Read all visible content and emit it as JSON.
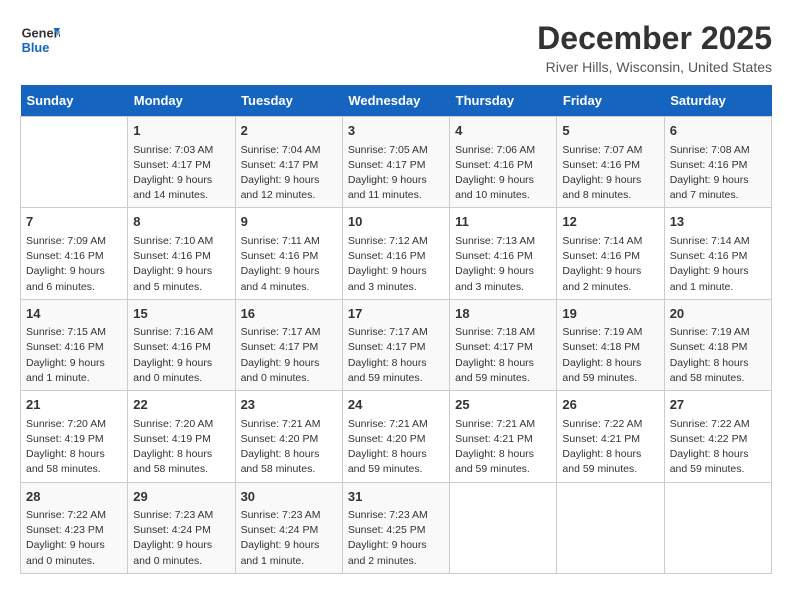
{
  "header": {
    "logo_line1": "General",
    "logo_line2": "Blue",
    "month_title": "December 2025",
    "location": "River Hills, Wisconsin, United States"
  },
  "days_of_week": [
    "Sunday",
    "Monday",
    "Tuesday",
    "Wednesday",
    "Thursday",
    "Friday",
    "Saturday"
  ],
  "weeks": [
    [
      {
        "day": "",
        "sunrise": "",
        "sunset": "",
        "daylight": ""
      },
      {
        "day": "1",
        "sunrise": "Sunrise: 7:03 AM",
        "sunset": "Sunset: 4:17 PM",
        "daylight": "Daylight: 9 hours and 14 minutes."
      },
      {
        "day": "2",
        "sunrise": "Sunrise: 7:04 AM",
        "sunset": "Sunset: 4:17 PM",
        "daylight": "Daylight: 9 hours and 12 minutes."
      },
      {
        "day": "3",
        "sunrise": "Sunrise: 7:05 AM",
        "sunset": "Sunset: 4:17 PM",
        "daylight": "Daylight: 9 hours and 11 minutes."
      },
      {
        "day": "4",
        "sunrise": "Sunrise: 7:06 AM",
        "sunset": "Sunset: 4:16 PM",
        "daylight": "Daylight: 9 hours and 10 minutes."
      },
      {
        "day": "5",
        "sunrise": "Sunrise: 7:07 AM",
        "sunset": "Sunset: 4:16 PM",
        "daylight": "Daylight: 9 hours and 8 minutes."
      },
      {
        "day": "6",
        "sunrise": "Sunrise: 7:08 AM",
        "sunset": "Sunset: 4:16 PM",
        "daylight": "Daylight: 9 hours and 7 minutes."
      }
    ],
    [
      {
        "day": "7",
        "sunrise": "Sunrise: 7:09 AM",
        "sunset": "Sunset: 4:16 PM",
        "daylight": "Daylight: 9 hours and 6 minutes."
      },
      {
        "day": "8",
        "sunrise": "Sunrise: 7:10 AM",
        "sunset": "Sunset: 4:16 PM",
        "daylight": "Daylight: 9 hours and 5 minutes."
      },
      {
        "day": "9",
        "sunrise": "Sunrise: 7:11 AM",
        "sunset": "Sunset: 4:16 PM",
        "daylight": "Daylight: 9 hours and 4 minutes."
      },
      {
        "day": "10",
        "sunrise": "Sunrise: 7:12 AM",
        "sunset": "Sunset: 4:16 PM",
        "daylight": "Daylight: 9 hours and 3 minutes."
      },
      {
        "day": "11",
        "sunrise": "Sunrise: 7:13 AM",
        "sunset": "Sunset: 4:16 PM",
        "daylight": "Daylight: 9 hours and 3 minutes."
      },
      {
        "day": "12",
        "sunrise": "Sunrise: 7:14 AM",
        "sunset": "Sunset: 4:16 PM",
        "daylight": "Daylight: 9 hours and 2 minutes."
      },
      {
        "day": "13",
        "sunrise": "Sunrise: 7:14 AM",
        "sunset": "Sunset: 4:16 PM",
        "daylight": "Daylight: 9 hours and 1 minute."
      }
    ],
    [
      {
        "day": "14",
        "sunrise": "Sunrise: 7:15 AM",
        "sunset": "Sunset: 4:16 PM",
        "daylight": "Daylight: 9 hours and 1 minute."
      },
      {
        "day": "15",
        "sunrise": "Sunrise: 7:16 AM",
        "sunset": "Sunset: 4:16 PM",
        "daylight": "Daylight: 9 hours and 0 minutes."
      },
      {
        "day": "16",
        "sunrise": "Sunrise: 7:17 AM",
        "sunset": "Sunset: 4:17 PM",
        "daylight": "Daylight: 9 hours and 0 minutes."
      },
      {
        "day": "17",
        "sunrise": "Sunrise: 7:17 AM",
        "sunset": "Sunset: 4:17 PM",
        "daylight": "Daylight: 8 hours and 59 minutes."
      },
      {
        "day": "18",
        "sunrise": "Sunrise: 7:18 AM",
        "sunset": "Sunset: 4:17 PM",
        "daylight": "Daylight: 8 hours and 59 minutes."
      },
      {
        "day": "19",
        "sunrise": "Sunrise: 7:19 AM",
        "sunset": "Sunset: 4:18 PM",
        "daylight": "Daylight: 8 hours and 59 minutes."
      },
      {
        "day": "20",
        "sunrise": "Sunrise: 7:19 AM",
        "sunset": "Sunset: 4:18 PM",
        "daylight": "Daylight: 8 hours and 58 minutes."
      }
    ],
    [
      {
        "day": "21",
        "sunrise": "Sunrise: 7:20 AM",
        "sunset": "Sunset: 4:19 PM",
        "daylight": "Daylight: 8 hours and 58 minutes."
      },
      {
        "day": "22",
        "sunrise": "Sunrise: 7:20 AM",
        "sunset": "Sunset: 4:19 PM",
        "daylight": "Daylight: 8 hours and 58 minutes."
      },
      {
        "day": "23",
        "sunrise": "Sunrise: 7:21 AM",
        "sunset": "Sunset: 4:20 PM",
        "daylight": "Daylight: 8 hours and 58 minutes."
      },
      {
        "day": "24",
        "sunrise": "Sunrise: 7:21 AM",
        "sunset": "Sunset: 4:20 PM",
        "daylight": "Daylight: 8 hours and 59 minutes."
      },
      {
        "day": "25",
        "sunrise": "Sunrise: 7:21 AM",
        "sunset": "Sunset: 4:21 PM",
        "daylight": "Daylight: 8 hours and 59 minutes."
      },
      {
        "day": "26",
        "sunrise": "Sunrise: 7:22 AM",
        "sunset": "Sunset: 4:21 PM",
        "daylight": "Daylight: 8 hours and 59 minutes."
      },
      {
        "day": "27",
        "sunrise": "Sunrise: 7:22 AM",
        "sunset": "Sunset: 4:22 PM",
        "daylight": "Daylight: 8 hours and 59 minutes."
      }
    ],
    [
      {
        "day": "28",
        "sunrise": "Sunrise: 7:22 AM",
        "sunset": "Sunset: 4:23 PM",
        "daylight": "Daylight: 9 hours and 0 minutes."
      },
      {
        "day": "29",
        "sunrise": "Sunrise: 7:23 AM",
        "sunset": "Sunset: 4:24 PM",
        "daylight": "Daylight: 9 hours and 0 minutes."
      },
      {
        "day": "30",
        "sunrise": "Sunrise: 7:23 AM",
        "sunset": "Sunset: 4:24 PM",
        "daylight": "Daylight: 9 hours and 1 minute."
      },
      {
        "day": "31",
        "sunrise": "Sunrise: 7:23 AM",
        "sunset": "Sunset: 4:25 PM",
        "daylight": "Daylight: 9 hours and 2 minutes."
      },
      {
        "day": "",
        "sunrise": "",
        "sunset": "",
        "daylight": ""
      },
      {
        "day": "",
        "sunrise": "",
        "sunset": "",
        "daylight": ""
      },
      {
        "day": "",
        "sunrise": "",
        "sunset": "",
        "daylight": ""
      }
    ]
  ]
}
